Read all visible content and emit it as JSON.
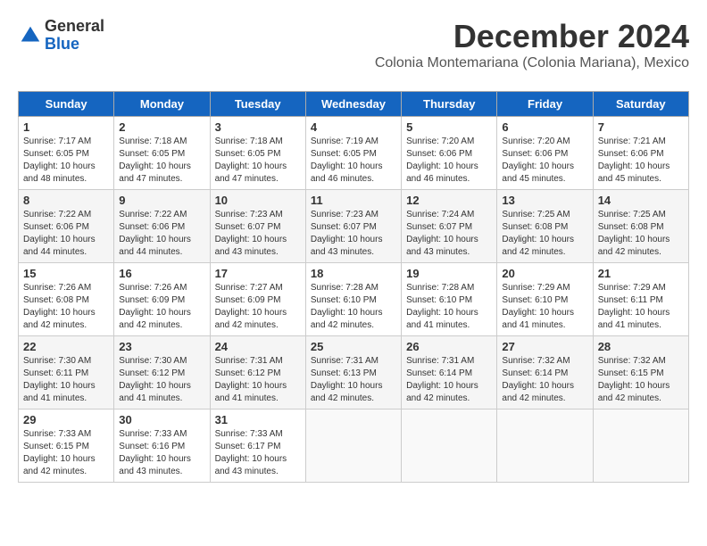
{
  "logo": {
    "line1": "General",
    "line2": "Blue"
  },
  "title": "December 2024",
  "subtitle": "Colonia Montemariana (Colonia Mariana), Mexico",
  "days_of_week": [
    "Sunday",
    "Monday",
    "Tuesday",
    "Wednesday",
    "Thursday",
    "Friday",
    "Saturday"
  ],
  "weeks": [
    [
      {
        "day": 1,
        "rise": "7:17 AM",
        "set": "6:05 PM",
        "daylight": "10 hours and 48 minutes."
      },
      {
        "day": 2,
        "rise": "7:18 AM",
        "set": "6:05 PM",
        "daylight": "10 hours and 47 minutes."
      },
      {
        "day": 3,
        "rise": "7:18 AM",
        "set": "6:05 PM",
        "daylight": "10 hours and 47 minutes."
      },
      {
        "day": 4,
        "rise": "7:19 AM",
        "set": "6:05 PM",
        "daylight": "10 hours and 46 minutes."
      },
      {
        "day": 5,
        "rise": "7:20 AM",
        "set": "6:06 PM",
        "daylight": "10 hours and 46 minutes."
      },
      {
        "day": 6,
        "rise": "7:20 AM",
        "set": "6:06 PM",
        "daylight": "10 hours and 45 minutes."
      },
      {
        "day": 7,
        "rise": "7:21 AM",
        "set": "6:06 PM",
        "daylight": "10 hours and 45 minutes."
      }
    ],
    [
      {
        "day": 8,
        "rise": "7:22 AM",
        "set": "6:06 PM",
        "daylight": "10 hours and 44 minutes."
      },
      {
        "day": 9,
        "rise": "7:22 AM",
        "set": "6:06 PM",
        "daylight": "10 hours and 44 minutes."
      },
      {
        "day": 10,
        "rise": "7:23 AM",
        "set": "6:07 PM",
        "daylight": "10 hours and 43 minutes."
      },
      {
        "day": 11,
        "rise": "7:23 AM",
        "set": "6:07 PM",
        "daylight": "10 hours and 43 minutes."
      },
      {
        "day": 12,
        "rise": "7:24 AM",
        "set": "6:07 PM",
        "daylight": "10 hours and 43 minutes."
      },
      {
        "day": 13,
        "rise": "7:25 AM",
        "set": "6:08 PM",
        "daylight": "10 hours and 42 minutes."
      },
      {
        "day": 14,
        "rise": "7:25 AM",
        "set": "6:08 PM",
        "daylight": "10 hours and 42 minutes."
      }
    ],
    [
      {
        "day": 15,
        "rise": "7:26 AM",
        "set": "6:08 PM",
        "daylight": "10 hours and 42 minutes."
      },
      {
        "day": 16,
        "rise": "7:26 AM",
        "set": "6:09 PM",
        "daylight": "10 hours and 42 minutes."
      },
      {
        "day": 17,
        "rise": "7:27 AM",
        "set": "6:09 PM",
        "daylight": "10 hours and 42 minutes."
      },
      {
        "day": 18,
        "rise": "7:28 AM",
        "set": "6:10 PM",
        "daylight": "10 hours and 42 minutes."
      },
      {
        "day": 19,
        "rise": "7:28 AM",
        "set": "6:10 PM",
        "daylight": "10 hours and 41 minutes."
      },
      {
        "day": 20,
        "rise": "7:29 AM",
        "set": "6:10 PM",
        "daylight": "10 hours and 41 minutes."
      },
      {
        "day": 21,
        "rise": "7:29 AM",
        "set": "6:11 PM",
        "daylight": "10 hours and 41 minutes."
      }
    ],
    [
      {
        "day": 22,
        "rise": "7:30 AM",
        "set": "6:11 PM",
        "daylight": "10 hours and 41 minutes."
      },
      {
        "day": 23,
        "rise": "7:30 AM",
        "set": "6:12 PM",
        "daylight": "10 hours and 41 minutes."
      },
      {
        "day": 24,
        "rise": "7:31 AM",
        "set": "6:12 PM",
        "daylight": "10 hours and 41 minutes."
      },
      {
        "day": 25,
        "rise": "7:31 AM",
        "set": "6:13 PM",
        "daylight": "10 hours and 42 minutes."
      },
      {
        "day": 26,
        "rise": "7:31 AM",
        "set": "6:14 PM",
        "daylight": "10 hours and 42 minutes."
      },
      {
        "day": 27,
        "rise": "7:32 AM",
        "set": "6:14 PM",
        "daylight": "10 hours and 42 minutes."
      },
      {
        "day": 28,
        "rise": "7:32 AM",
        "set": "6:15 PM",
        "daylight": "10 hours and 42 minutes."
      }
    ],
    [
      {
        "day": 29,
        "rise": "7:33 AM",
        "set": "6:15 PM",
        "daylight": "10 hours and 42 minutes."
      },
      {
        "day": 30,
        "rise": "7:33 AM",
        "set": "6:16 PM",
        "daylight": "10 hours and 43 minutes."
      },
      {
        "day": 31,
        "rise": "7:33 AM",
        "set": "6:17 PM",
        "daylight": "10 hours and 43 minutes."
      },
      null,
      null,
      null,
      null
    ]
  ]
}
